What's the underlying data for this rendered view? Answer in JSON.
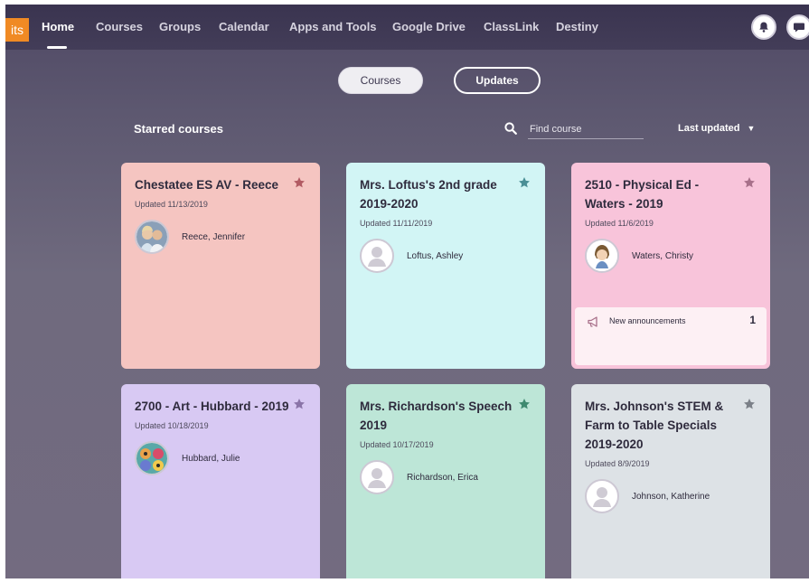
{
  "nav": {
    "logo": "its",
    "items": [
      {
        "label": "Home"
      },
      {
        "label": "Courses"
      },
      {
        "label": "Groups"
      },
      {
        "label": "Calendar"
      },
      {
        "label": "Apps and Tools"
      },
      {
        "label": "Google Drive"
      },
      {
        "label": "ClassLink"
      },
      {
        "label": "Destiny"
      }
    ]
  },
  "toggle": {
    "courses_label": "Courses",
    "updates_label": "Updates"
  },
  "starred": {
    "title": "Starred courses",
    "search_placeholder": "Find course",
    "sort_label": "Last updated"
  },
  "courses": [
    {
      "title": "Chestatee ES AV - Reece",
      "updated": "Updated 11/13/2019",
      "teacher": "Reece, Jennifer",
      "color": "#f5c5c1",
      "star_color": "#b25b63"
    },
    {
      "title": "Mrs. Loftus's 2nd grade 2019-2020",
      "updated": "Updated 11/11/2019",
      "teacher": "Loftus, Ashley",
      "color": "#d2f5f5",
      "star_color": "#4a8f96"
    },
    {
      "title": "2510 - Physical Ed - Waters - 2019",
      "updated": "Updated 11/6/2019",
      "teacher": "Waters, Christy",
      "color": "#f8c4da",
      "star_color": "#a8708a",
      "announcement_label": "New announcements",
      "announcement_count": "1"
    },
    {
      "title": "2700 - Art - Hubbard - 2019",
      "updated": "Updated 10/18/2019",
      "teacher": "Hubbard, Julie",
      "color": "#d8c9f3",
      "star_color": "#8a74a8"
    },
    {
      "title": "Mrs. Richardson's Speech 2019",
      "updated": "Updated 10/17/2019",
      "teacher": "Richardson, Erica",
      "color": "#bde6d7",
      "star_color": "#3f8a70"
    },
    {
      "title": "Mrs. Johnson's STEM & Farm to Table Specials 2019-2020",
      "updated": "Updated 8/9/2019",
      "teacher": "Johnson, Katherine",
      "color": "#dde2e6",
      "star_color": "#7b8088"
    }
  ]
}
